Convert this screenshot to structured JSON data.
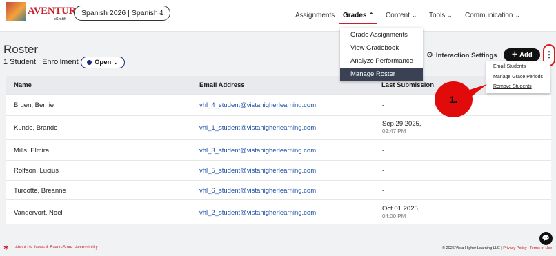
{
  "app": {
    "brand": "AVENTURAS",
    "brand_sub": "eSmith",
    "course_select": {
      "course": "Spanish 2026",
      "section": "Spanish 1"
    },
    "nav": [
      "Assignments",
      "Grades",
      "Content",
      "Tools",
      "Communication"
    ],
    "active_nav": "Grades"
  },
  "grades_menu": {
    "items": [
      "Grade Assignments",
      "View Gradebook",
      "Analyze Performance",
      "Manage Roster"
    ],
    "selected": "Manage Roster"
  },
  "roster": {
    "title": "Roster",
    "summary": "1 Student | Enrollment",
    "status": "Open",
    "interaction_settings": "Interaction Settings",
    "add_label": "Add",
    "more_icon": "kebab-icon"
  },
  "more_menu": {
    "items": [
      "Email Students",
      "Manage Grace Periods",
      "Remove Students"
    ]
  },
  "callout": {
    "label": "1."
  },
  "table": {
    "columns": [
      "Name",
      "Email Address",
      "Last Submission"
    ],
    "rows": [
      {
        "name": "Bruen, Bernie",
        "email": "vhl_4_student@vistahigherlearning.com",
        "last_date": "-",
        "last_time": ""
      },
      {
        "name": "Kunde, Brando",
        "email": "vhl_1_student@vistahigherlearning.com",
        "last_date": "Sep 29 2025,",
        "last_time": "02:47 PM"
      },
      {
        "name": "Mills, Elmira",
        "email": "vhl_3_student@vistahigherlearning.com",
        "last_date": "-",
        "last_time": ""
      },
      {
        "name": "Rolfson, Lucius",
        "email": "vhl_5_student@vistahigherlearning.com",
        "last_date": "-",
        "last_time": ""
      },
      {
        "name": "Turcotte, Breanne",
        "email": "vhl_6_student@vistahigherlearning.com",
        "last_date": "-",
        "last_time": ""
      },
      {
        "name": "Vandervort, Noel",
        "email": "vhl_2_student@vistahigherlearning.com",
        "last_date": "Oct 01 2025,",
        "last_time": "04:00 PM"
      }
    ]
  },
  "footer": {
    "links": [
      "About Us",
      "News & Events",
      "Store",
      "Accessibility"
    ],
    "copyright": "© 2026 Vista Higher Learning LLC |",
    "privacy": "Privacy Policy",
    "terms": "Terms of Use",
    "sep": "|"
  },
  "colors": {
    "brand_red": "#c8202b",
    "dark": "#111111",
    "link_blue": "#1f4fa8",
    "menu_selected": "#3a4154",
    "callout_red": "#e10b0b"
  }
}
